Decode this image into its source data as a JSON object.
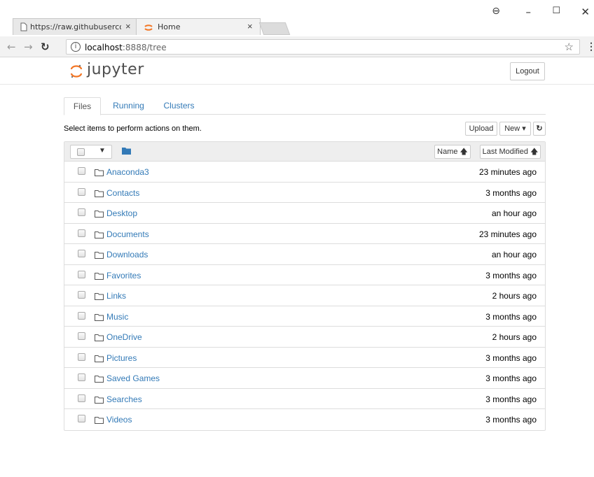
{
  "browser": {
    "tabs": [
      {
        "label": "https://raw.githubuserco"
      },
      {
        "label": "Home"
      }
    ],
    "address": {
      "host": "localhost",
      "path": ":8888/tree"
    }
  },
  "header": {
    "logo_text": "jupyter",
    "logout_label": "Logout"
  },
  "nav_tabs": [
    {
      "label": "Files"
    },
    {
      "label": "Running"
    },
    {
      "label": "Clusters"
    }
  ],
  "toolbar": {
    "instructions": "Select items to perform actions on them.",
    "upload_label": "Upload",
    "new_label": "New ▾",
    "refresh_glyph": "↻"
  },
  "list_header": {
    "name_sort": "Name 🡅",
    "modified_sort": "Last Modified 🡅"
  },
  "items": [
    {
      "name": "Anaconda3",
      "modified": "23 minutes ago"
    },
    {
      "name": "Contacts",
      "modified": "3 months ago"
    },
    {
      "name": "Desktop",
      "modified": "an hour ago"
    },
    {
      "name": "Documents",
      "modified": "23 minutes ago"
    },
    {
      "name": "Downloads",
      "modified": "an hour ago"
    },
    {
      "name": "Favorites",
      "modified": "3 months ago"
    },
    {
      "name": "Links",
      "modified": "2 hours ago"
    },
    {
      "name": "Music",
      "modified": "3 months ago"
    },
    {
      "name": "OneDrive",
      "modified": "2 hours ago"
    },
    {
      "name": "Pictures",
      "modified": "3 months ago"
    },
    {
      "name": "Saved Games",
      "modified": "3 months ago"
    },
    {
      "name": "Searches",
      "modified": "3 months ago"
    },
    {
      "name": "Videos",
      "modified": "3 months ago"
    }
  ],
  "colors": {
    "link": "#337ab7",
    "jupyter_orange": "#f37726"
  }
}
